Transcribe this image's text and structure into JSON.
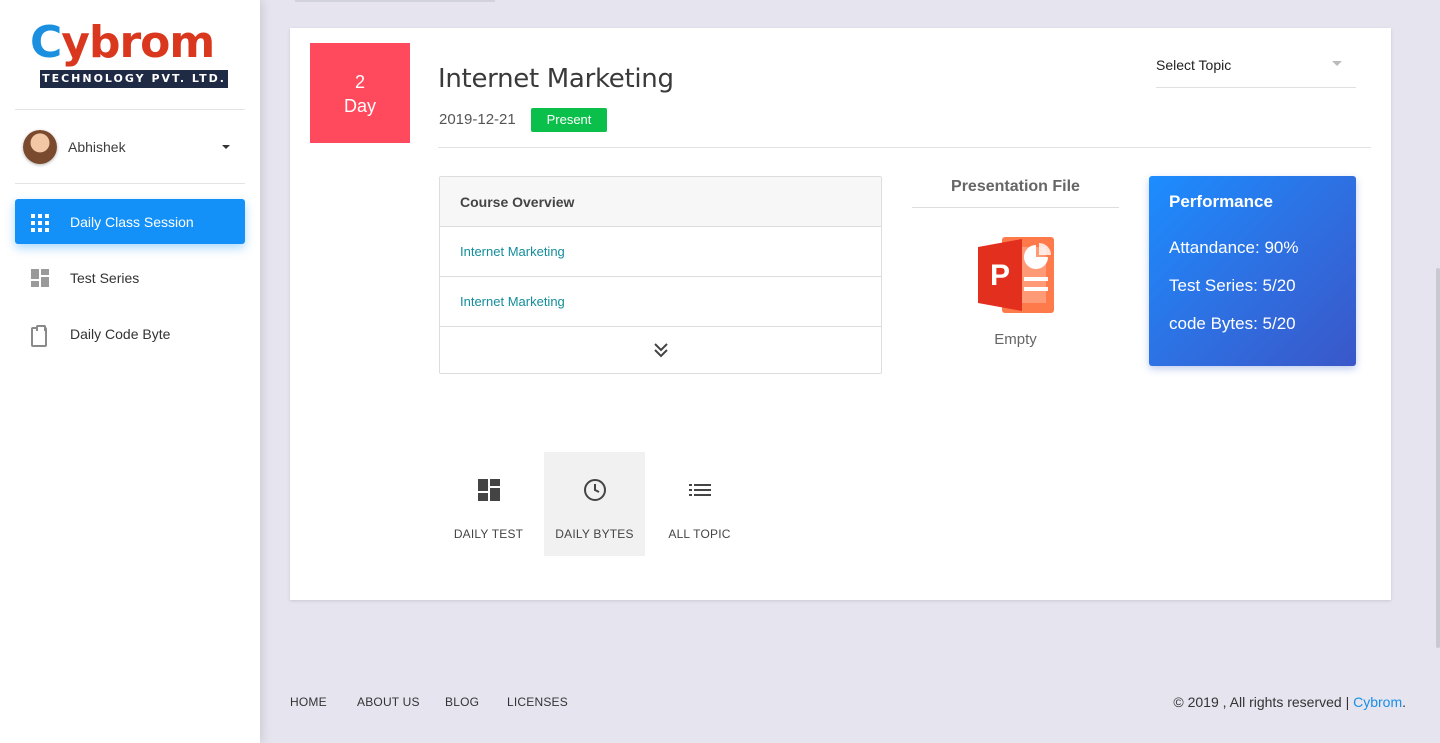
{
  "brand": {
    "logo_first": "C",
    "logo_rest": "ybrom",
    "tagline": "TECHNOLOGY PVT. LTD.",
    "accent_blue": "#1391f8",
    "accent_red": "#d9381e"
  },
  "user": {
    "name": "Abhishek"
  },
  "sidebar": {
    "items": [
      {
        "label": "Daily Class Session",
        "icon": "apps-grid-icon",
        "active": true
      },
      {
        "label": "Test Series",
        "icon": "dashboard-icon",
        "active": false
      },
      {
        "label": "Daily Code Byte",
        "icon": "clipboard-icon",
        "active": false
      }
    ]
  },
  "session": {
    "day_number": "2",
    "day_label": "Day",
    "title": "Internet Marketing",
    "date": "2019-12-21",
    "status": "Present",
    "status_color": "#0bbf4b",
    "day_color": "#ff4a5e"
  },
  "topic_select": {
    "selected": "Select Topic"
  },
  "overview": {
    "heading": "Course Overview",
    "items": [
      "Internet Marketing",
      "Internet Marketing"
    ],
    "more_icon": "chevron-double-down-icon"
  },
  "presentation": {
    "heading": "Presentation File",
    "file_icon": "powerpoint-icon",
    "status": "Empty"
  },
  "performance": {
    "heading": "Performance",
    "rows": [
      "Attandance: 90%",
      "Test Series: 5/20",
      "code Bytes: 5/20"
    ]
  },
  "tabs": [
    {
      "label": "DAILY TEST",
      "icon": "dashboard-icon",
      "active": false
    },
    {
      "label": "DAILY BYTES",
      "icon": "clock-icon",
      "active": true
    },
    {
      "label": "ALL TOPIC",
      "icon": "list-icon",
      "active": false
    }
  ],
  "footer": {
    "links": [
      "HOME",
      "ABOUT US",
      "BLOG",
      "LICENSES"
    ],
    "copyright": "© 2019 , All rights reserved | ",
    "company": "Cybrom",
    "period": "."
  }
}
